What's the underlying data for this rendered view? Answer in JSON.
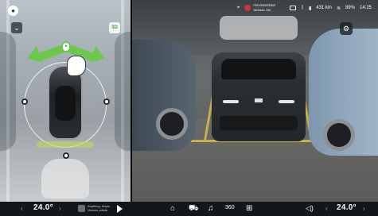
{
  "status_bar": {
    "notice_line1": "FEHÖRERRER",
    "notice_line2": "SIGNAL ON",
    "range": "431 km",
    "battery": "89%",
    "time": "14:25"
  },
  "left_view": {
    "mode_3d_label": "3D",
    "icons": {
      "profile": "user-icon",
      "collapse": "chevron-down-icon",
      "mode": "3d-mode-icon"
    }
  },
  "bottom_bar": {
    "left_temp": "24.0°",
    "right_temp": "24.0°",
    "media_title": "Anything, Anyw...",
    "media_subtitle": "Various artists",
    "dock_icons": [
      "home-icon",
      "car-icon",
      "music-icon",
      "camera-360-icon",
      "apps-icon"
    ],
    "camera_label": "360"
  },
  "colors": {
    "arrow_green": "#6cc84a",
    "accent_green": "#2ea14b",
    "bar_bg": "#13161a"
  }
}
